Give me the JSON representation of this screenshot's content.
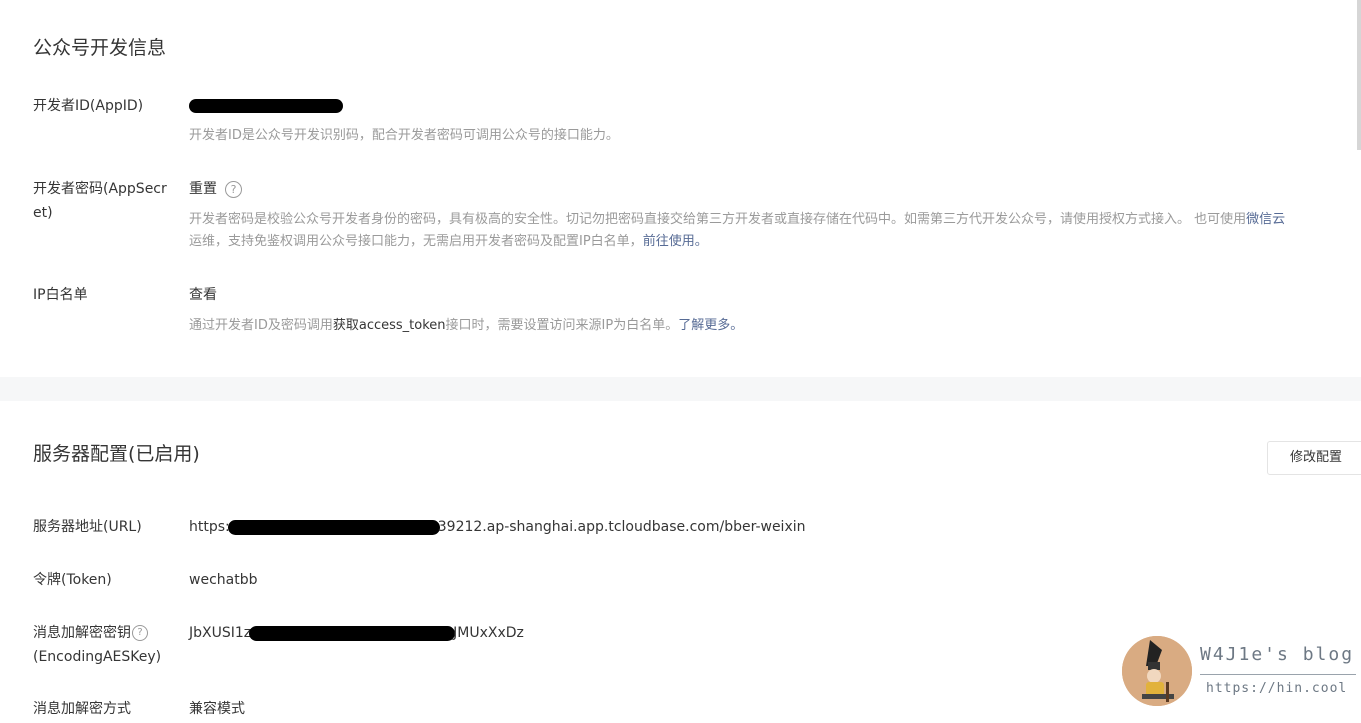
{
  "developer_info": {
    "title": "公众号开发信息",
    "appid": {
      "label": "开发者ID(AppID)",
      "desc": "开发者ID是公众号开发识别码，配合开发者密码可调用公众号的接口能力。"
    },
    "appsecret": {
      "label": "开发者密码(AppSecret)",
      "action": "重置",
      "desc_line1": "开发者密码是校验公众号开发者身份的密码，具有极高的安全性。切记勿把密码直接交给第三方开发者或直接存储在代码中。如需第三方代开发公众号，请使用授权方式接入。 也可使用",
      "desc_line1_link": "微信云",
      "desc_line2": "运维，支持免鉴权调用公众号接口能力，无需启用开发者密码及配置IP白名单，",
      "desc_line2_link": "前往使用。"
    },
    "ip_whitelist": {
      "label": "IP白名单",
      "action": "查看",
      "desc_prefix": "通过开发者ID及密码调用",
      "desc_link": "获取access_token",
      "desc_middle": "接口时，需要设置访问来源IP为白名单。",
      "desc_link2": "了解更多。"
    }
  },
  "server_config": {
    "title": "服务器配置(已启用)",
    "modify_button": "修改配置",
    "url": {
      "label": "服务器地址(URL)",
      "value_prefix": "https:",
      "value_suffix": "39212.ap-shanghai.app.tcloudbase.com/bber-weixin"
    },
    "token": {
      "label": "令牌(Token)",
      "value": "wechatbb"
    },
    "aes_key": {
      "label_line1": "消息加解密密钥",
      "label_line2": "(EncodingAESKey)",
      "value_prefix": "JbXUSI1z",
      "value_suffix": "JMUxXxDz"
    },
    "encrypt_mode": {
      "label": "消息加解密方式",
      "value": "兼容模式"
    }
  },
  "watermark": {
    "title": "W4J1e's blog",
    "url": "https://hin.cool"
  },
  "icons": {
    "help": "question-circle-icon",
    "avatar": "avatar-image"
  },
  "colors": {
    "link": "#576b95",
    "muted": "#9a9a9a",
    "text": "#353535",
    "band": "#f6f7f8"
  }
}
